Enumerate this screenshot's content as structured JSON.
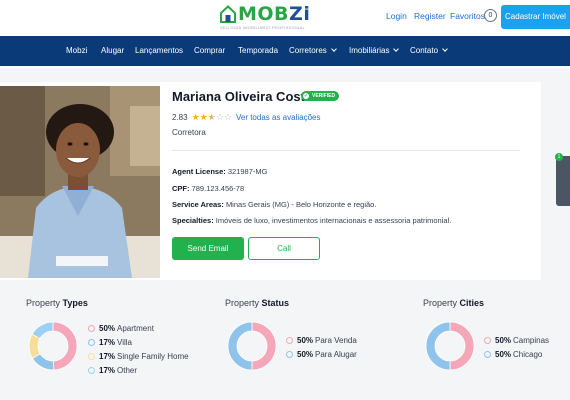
{
  "header": {
    "logo_text_a": "MOB",
    "logo_text_b": "Zi",
    "logo_tagline": "SEU GUIA IMOBILIÁRIO PROFISSIONAL",
    "login": "Login",
    "register": "Register",
    "favorites": "Favoritos",
    "favorites_count": "0",
    "cta": "Cadastrar Imóvel"
  },
  "nav": {
    "items": [
      {
        "label": "Mobzi",
        "dropdown": false
      },
      {
        "label": "Alugar",
        "dropdown": false
      },
      {
        "label": "Lançamentos",
        "dropdown": false
      },
      {
        "label": "Comprar",
        "dropdown": false
      },
      {
        "label": "Temporada",
        "dropdown": false
      },
      {
        "label": "Corretores",
        "dropdown": true
      },
      {
        "label": "Imobiliárias",
        "dropdown": true
      },
      {
        "label": "Contato",
        "dropdown": true
      }
    ]
  },
  "profile": {
    "name": "Mariana Oliveira Costa",
    "verified": "VERIFIED",
    "rating_value": "2.83",
    "rating_stars": 2.5,
    "reviews_link": "Ver todas as avaliações",
    "role": "Corretora",
    "license_label": "Agent License:",
    "license_value": "321987-MG",
    "cpf_label": "CPF:",
    "cpf_value": "789.123.456-78",
    "areas_label": "Service Areas:",
    "areas_value": "Minas Gerais (MG) - Belo Horizonte e região.",
    "specialties_label": "Specialties:",
    "specialties_value": "Imóveis de luxo, investimentos internacionais e assessoria patrimonial.",
    "email_button": "Send Email",
    "call_button": "Call"
  },
  "side_widget": {
    "badge": "1"
  },
  "stats": [
    {
      "title_prefix": "Property",
      "title_strong": "Types",
      "items": [
        {
          "pct": "50%",
          "label": "Apartment",
          "value": 50,
          "color": "#f4a7b9"
        },
        {
          "pct": "17%",
          "label": "Villa",
          "value": 17,
          "color": "#8fc3ec"
        },
        {
          "pct": "17%",
          "label": "Single Family Home",
          "value": 17,
          "color": "#f7dd9a"
        },
        {
          "pct": "17%",
          "label": "Other",
          "value": 17,
          "color": "#9ed0f5"
        }
      ]
    },
    {
      "title_prefix": "Property",
      "title_strong": "Status",
      "items": [
        {
          "pct": "50%",
          "label": "Para Venda",
          "value": 50,
          "color": "#f4a7b9"
        },
        {
          "pct": "50%",
          "label": "Para Alugar",
          "value": 50,
          "color": "#8fc3ec"
        }
      ]
    },
    {
      "title_prefix": "Property",
      "title_strong": "Cities",
      "items": [
        {
          "pct": "50%",
          "label": "Campinas",
          "value": 50,
          "color": "#f4a7b9"
        },
        {
          "pct": "50%",
          "label": "Chicago",
          "value": 50,
          "color": "#8fc3ec"
        }
      ]
    }
  ]
}
